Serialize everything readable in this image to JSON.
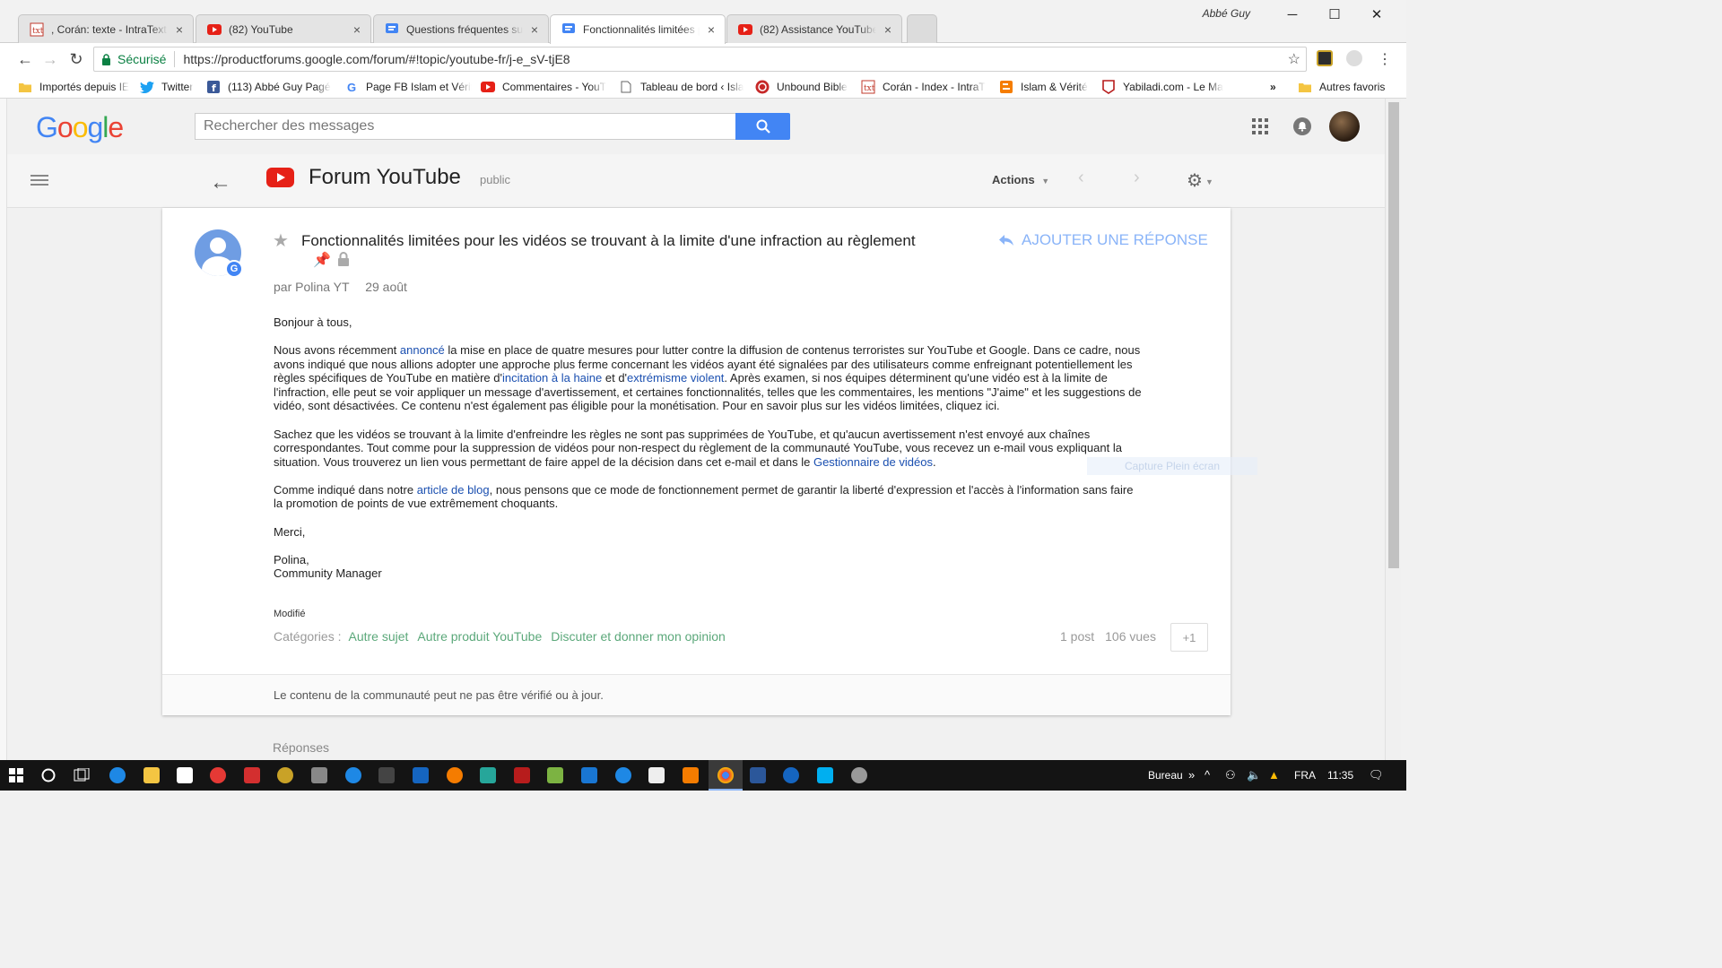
{
  "browser": {
    "tabs": [
      {
        "title": ", Corán: texte - IntraText C",
        "icon": "intratext-icon"
      },
      {
        "title": "(82) YouTube",
        "icon": "youtube-icon"
      },
      {
        "title": "Questions fréquentes sur",
        "icon": "forum-icon"
      },
      {
        "title": "Fonctionnalités limitées p",
        "icon": "forum-icon"
      },
      {
        "title": "(82) Assistance YouTube",
        "icon": "youtube-icon"
      }
    ],
    "user": "Abbé Guy",
    "secure_label": "Sécurisé",
    "url": "https://productforums.google.com/forum/#!topic/youtube-fr/j-e_sV-tjE8",
    "bookmarks": [
      {
        "label": "Importés depuis IE",
        "icon": "folder-icon"
      },
      {
        "label": "Twitter",
        "icon": "twitter-icon"
      },
      {
        "label": "(113) Abbé Guy Pagé",
        "icon": "facebook-icon"
      },
      {
        "label": "Page FB Islam et Vérit",
        "icon": "google-icon"
      },
      {
        "label": "Commentaires - YouT",
        "icon": "youtube-icon"
      },
      {
        "label": "Tableau de bord ‹ Isla",
        "icon": "page-icon"
      },
      {
        "label": "Unbound Bible",
        "icon": "unbound-icon"
      },
      {
        "label": "Corán - Index - IntraT",
        "icon": "intratext-icon"
      },
      {
        "label": "Islam & Vérité",
        "icon": "blogger-icon"
      },
      {
        "label": "Yabiladi.com - Le Ma",
        "icon": "yabiladi-icon"
      }
    ],
    "more_bookmarks": "»",
    "other_bookmarks": "Autres favoris"
  },
  "header": {
    "logo": "Google",
    "search_placeholder": "Rechercher des messages"
  },
  "forum": {
    "title": "Forum YouTube",
    "visibility": "public",
    "actions_label": "Actions"
  },
  "post": {
    "title": "Fonctionnalités limitées pour les vidéos se trouvant à la limite d'une infraction au règlement",
    "reply_label": "AJOUTER UNE RÉPONSE",
    "author": "par Polina YT",
    "date": "29 août",
    "greeting": "Bonjour à tous,",
    "p1_a": "Nous avons récemment ",
    "p1_link1": "annoncé",
    "p1_b": " la mise en place de quatre mesures pour lutter contre la diffusion de contenus terroristes sur YouTube et Google. Dans ce cadre, nous avons indiqué que nous allions adopter une approche plus ferme concernant les vidéos ayant été signalées par des utilisateurs comme enfreignant potentiellement les règles spécifiques de YouTube en matière d'",
    "p1_link2": "incitation à la haine",
    "p1_c": " et d'",
    "p1_link3": "extrémisme violent",
    "p1_d": ". Après examen, si nos équipes déterminent qu'une vidéo est à la limite de l'infraction, elle peut se voir appliquer un message d'avertissement, et certaines fonctionnalités, telles que les commentaires, les mentions \"J'aime\" et les suggestions de vidéo, sont désactivées. Ce contenu n'est également pas éligible pour la monétisation. Pour en savoir plus sur les vidéos limitées, cliquez ici.",
    "p2_a": "Sachez que les vidéos se trouvant à la limite d'enfreindre les règles ne sont pas supprimées de YouTube, et qu'aucun avertissement n'est envoyé aux chaînes correspondantes. Tout comme pour la suppression de vidéos pour non-respect du règlement de la communauté YouTube, vous recevez un e-mail vous expliquant la situation. Vous trouverez un lien vous permettant de faire appel de la décision dans cet e-mail et dans le ",
    "p2_link": "Gestionnaire de vidéos",
    "p2_b": ".",
    "p3_a": "Comme indiqué dans notre ",
    "p3_link": "article de blog",
    "p3_b": ", nous pensons que ce mode de fonctionnement permet de garantir la liberté d'expression et l'accès à l'information sans faire la promotion de points de vue extrêmement choquants.",
    "thanks": "Merci,",
    "signature_name": "Polina,",
    "signature_role": "Community Manager",
    "modified": "Modifié",
    "categories_label": "Catégories :",
    "categories": [
      "Autre sujet",
      "Autre produit YouTube",
      "Discuter et donner mon opinion"
    ],
    "posts_count": "1 post",
    "views_count": "106 vues",
    "plus_one": "+1",
    "footer_note": "Le contenu de la communauté peut ne pas être vérifié ou à jour."
  },
  "overlay_ghost": "Capture Plein écran",
  "replies_heading": "Réponses",
  "taskbar": {
    "bureau": "Bureau",
    "lang": "FRA",
    "time": "11:35"
  },
  "colors": {
    "google_blue": "#4285f4",
    "youtube_red": "#e62117",
    "link": "#1a4fb0",
    "category_green": "#5ba87a"
  }
}
